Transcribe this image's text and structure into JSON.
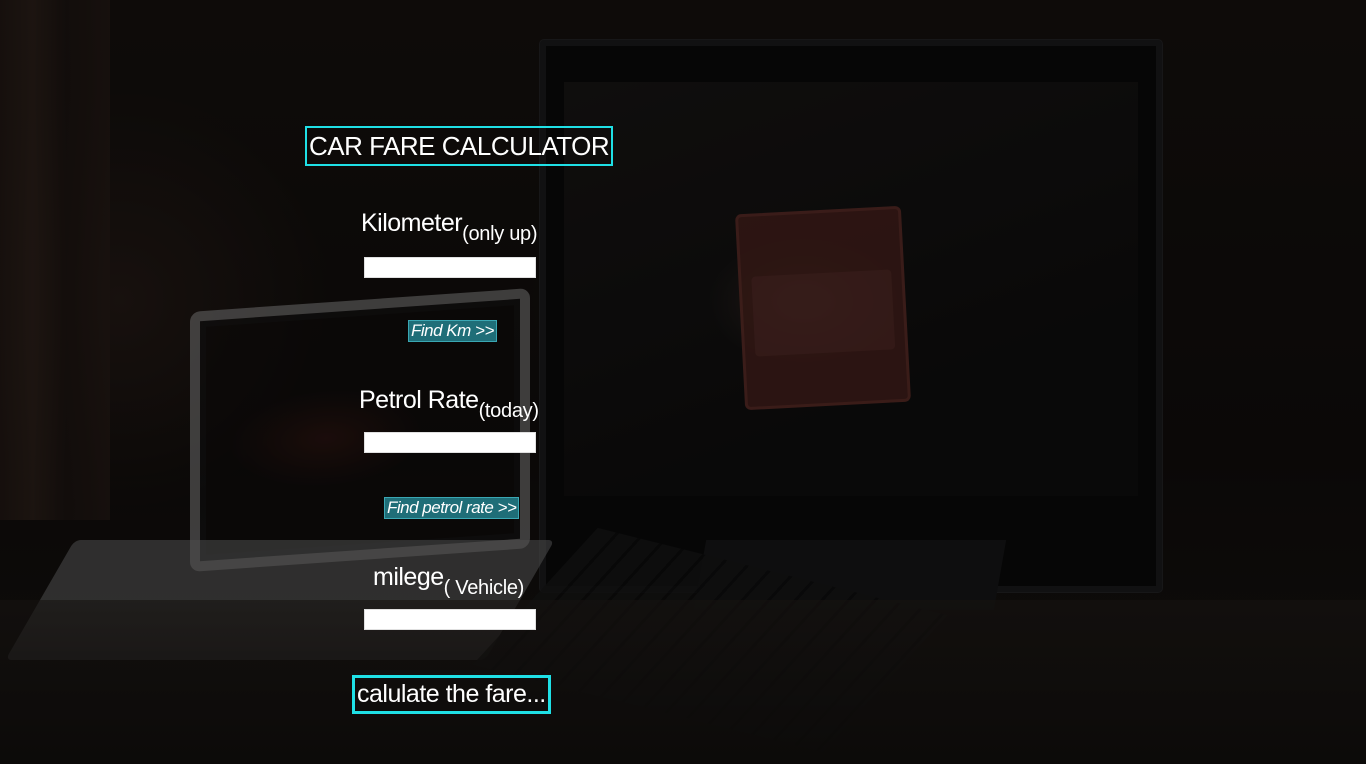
{
  "app": {
    "title": "CAR FARE CALCULATOR"
  },
  "fields": {
    "kilometer": {
      "label": "Kilometer",
      "sublabel": "(only up)",
      "value": "",
      "button": "Find Km >>"
    },
    "petrol_rate": {
      "label": "Petrol Rate",
      "sublabel": "(today)",
      "value": "",
      "button": "Find petrol rate >>"
    },
    "milege": {
      "label": "milege",
      "sublabel": "( Vehicle)",
      "value": ""
    }
  },
  "calculate_button": "calulate the fare...",
  "colors": {
    "accent_border": "#1fe0e6",
    "small_button_bg": "#1f6e78",
    "text": "#ffffff"
  },
  "background": {
    "description_icon": "workspace-photo-background"
  }
}
